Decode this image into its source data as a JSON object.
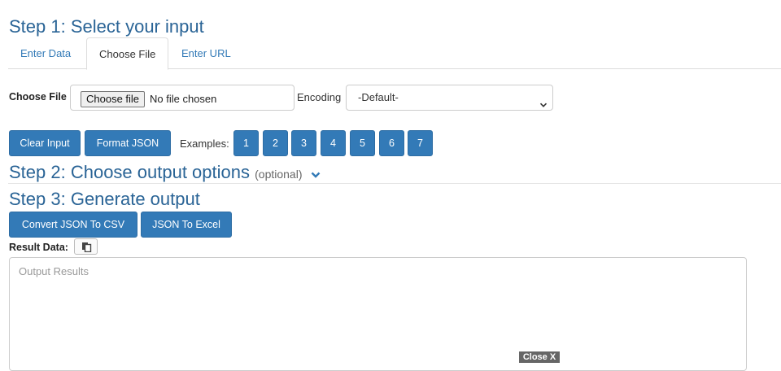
{
  "step1": {
    "title": "Step 1: Select your input"
  },
  "tabs": [
    {
      "label": "Enter Data",
      "active": false
    },
    {
      "label": "Choose File",
      "active": true
    },
    {
      "label": "Enter URL",
      "active": false
    }
  ],
  "file": {
    "label": "Choose File",
    "button_label": "Choose file",
    "status": "No file chosen"
  },
  "encoding": {
    "label": "Encoding",
    "selected": "-Default-"
  },
  "actions": {
    "clear_label": "Clear Input",
    "format_label": "Format JSON"
  },
  "examples": {
    "label": "Examples:",
    "items": [
      "1",
      "2",
      "3",
      "4",
      "5",
      "6",
      "7"
    ]
  },
  "step2": {
    "title": "Step 2: Choose output options",
    "optional": "(optional)"
  },
  "step3": {
    "title": "Step 3: Generate output"
  },
  "convert": {
    "csv_label": "Convert JSON To CSV",
    "excel_label": "JSON To Excel"
  },
  "result": {
    "label": "Result Data:",
    "placeholder": "Output Results"
  },
  "overlay": {
    "close_label": "Close X"
  },
  "colors": {
    "primary": "#337ab7",
    "heading": "#2a6496"
  }
}
